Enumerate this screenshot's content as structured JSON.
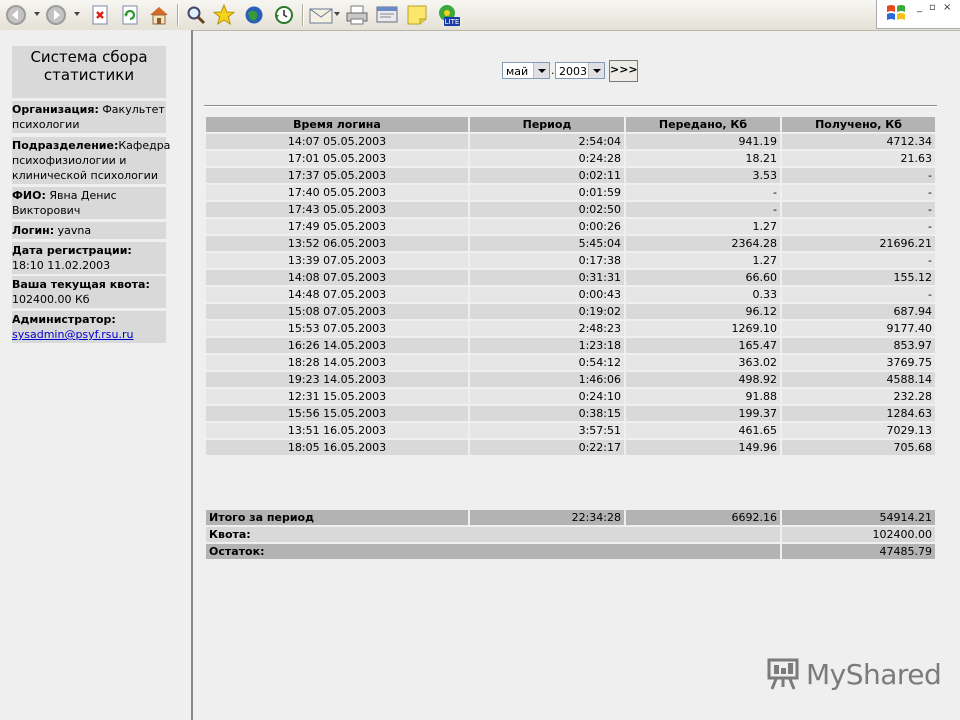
{
  "toolbar": {
    "buttons": [
      {
        "icon": "back-icon"
      },
      {
        "icon": "forward-icon"
      },
      {
        "icon": "stop-icon"
      },
      {
        "icon": "refresh-icon"
      },
      {
        "icon": "home-icon"
      },
      {
        "icon": "search-icon"
      },
      {
        "icon": "favorites-star-icon"
      },
      {
        "icon": "media-icon"
      },
      {
        "icon": "history-icon"
      },
      {
        "icon": "mail-icon"
      },
      {
        "icon": "print-icon"
      },
      {
        "icon": "edit-icon"
      },
      {
        "icon": "notes-icon"
      },
      {
        "icon": "icq-lite-icon",
        "badge": "LITE"
      }
    ],
    "window_controls": [
      "_",
      "▫",
      "×"
    ]
  },
  "sidebar": {
    "title": "Система сбора статистики",
    "info": [
      {
        "label": "Организация:",
        "value": " Факультет психологии"
      },
      {
        "label": "Подразделение:",
        "value": "Кафедра психофизиологии и клинической психологии"
      },
      {
        "label": "ФИО:",
        "value": " Явна Денис Викторович"
      },
      {
        "label": "Логин:",
        "value": " yavna"
      },
      {
        "label": "Дата регистрации:",
        "value": "18:10 11.02.2003"
      },
      {
        "label": "Ваша текущая квота:",
        "value": "102400.00 Кб"
      },
      {
        "label": "Администратор:",
        "link": "sysadmin@psyf.rsu.ru"
      }
    ]
  },
  "filter": {
    "month": "май",
    "separator": ".",
    "year": "2003",
    "go_label": ">>>"
  },
  "table": {
    "headers": [
      "Время логина",
      "Период",
      "Передано, Кб",
      "Получено, Кб"
    ],
    "rows": [
      [
        "14:07 05.05.2003",
        "2:54:04",
        "941.19",
        "4712.34"
      ],
      [
        "17:01 05.05.2003",
        "0:24:28",
        "18.21",
        "21.63"
      ],
      [
        "17:37 05.05.2003",
        "0:02:11",
        "3.53",
        "-"
      ],
      [
        "17:40 05.05.2003",
        "0:01:59",
        "-",
        "-"
      ],
      [
        "17:43 05.05.2003",
        "0:02:50",
        "-",
        "-"
      ],
      [
        "17:49 05.05.2003",
        "0:00:26",
        "1.27",
        "-"
      ],
      [
        "13:52 06.05.2003",
        "5:45:04",
        "2364.28",
        "21696.21"
      ],
      [
        "13:39 07.05.2003",
        "0:17:38",
        "1.27",
        "-"
      ],
      [
        "14:08 07.05.2003",
        "0:31:31",
        "66.60",
        "155.12"
      ],
      [
        "14:48 07.05.2003",
        "0:00:43",
        "0.33",
        "-"
      ],
      [
        "15:08 07.05.2003",
        "0:19:02",
        "96.12",
        "687.94"
      ],
      [
        "15:53 07.05.2003",
        "2:48:23",
        "1269.10",
        "9177.40"
      ],
      [
        "16:26 14.05.2003",
        "1:23:18",
        "165.47",
        "853.97"
      ],
      [
        "18:28 14.05.2003",
        "0:54:12",
        "363.02",
        "3769.75"
      ],
      [
        "19:23 14.05.2003",
        "1:46:06",
        "498.92",
        "4588.14"
      ],
      [
        "12:31 15.05.2003",
        "0:24:10",
        "91.88",
        "232.28"
      ],
      [
        "15:56 15.05.2003",
        "0:38:15",
        "199.37",
        "1284.63"
      ],
      [
        "13:51 16.05.2003",
        "3:57:51",
        "461.65",
        "7029.13"
      ],
      [
        "18:05 16.05.2003",
        "0:22:17",
        "149.96",
        "705.68"
      ]
    ]
  },
  "totals": {
    "period_label": "Итого за период",
    "period_time": "22:34:28",
    "period_sent": "6692.16",
    "period_received": "54914.21",
    "quota_label": "Квота:",
    "quota_value": "102400.00",
    "remaining_label": "Остаток:",
    "remaining_value": "47485.79"
  },
  "watermark": {
    "text": "MyShared",
    "icon": "presentation-board-icon"
  }
}
